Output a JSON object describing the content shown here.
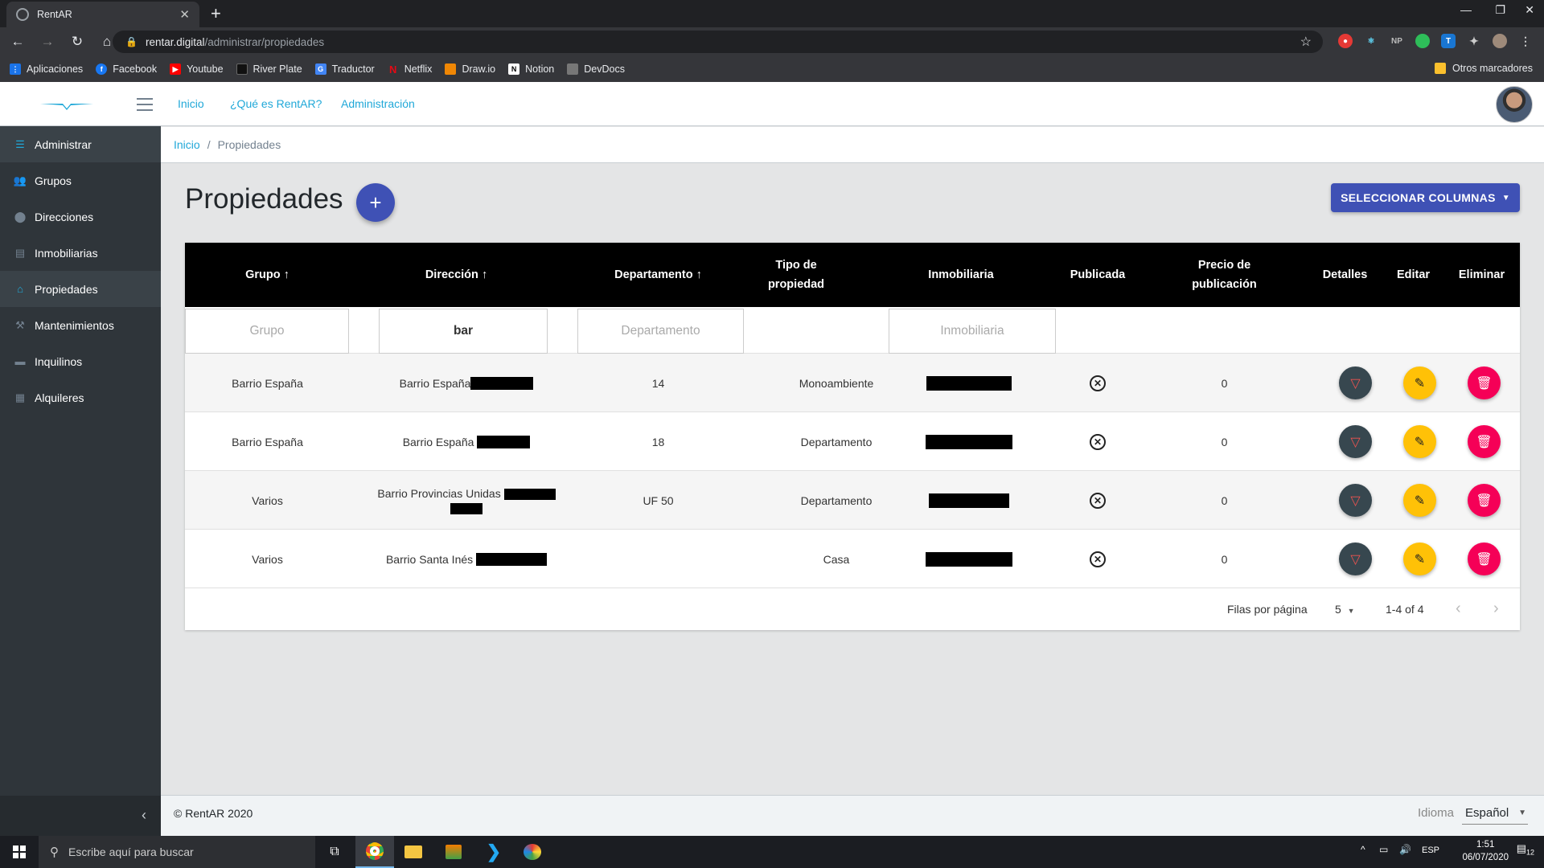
{
  "browser": {
    "tab_title": "RentAR",
    "url_host": "rentar.digital",
    "url_path": "/administrar/propiedades",
    "extensions": [
      "NP"
    ],
    "bookmarks": [
      "Aplicaciones",
      "Facebook",
      "Youtube",
      "River Plate",
      "Traductor",
      "Netflix",
      "Draw.io",
      "Notion",
      "DevDocs"
    ],
    "other_bookmarks": "Otros marcadores"
  },
  "header": {
    "nav": [
      "Inicio",
      "¿Qué es RentAR?",
      "Administración"
    ]
  },
  "sidebar": {
    "items": [
      {
        "label": "Administrar",
        "icon": "list-icon"
      },
      {
        "label": "Grupos",
        "icon": "users-icon"
      },
      {
        "label": "Direcciones",
        "icon": "map-pin-icon"
      },
      {
        "label": "Inmobiliarias",
        "icon": "building-icon"
      },
      {
        "label": "Propiedades",
        "icon": "home-icon"
      },
      {
        "label": "Mantenimientos",
        "icon": "hammer-icon"
      },
      {
        "label": "Inquilinos",
        "icon": "bed-icon"
      },
      {
        "label": "Alquileres",
        "icon": "document-icon"
      }
    ]
  },
  "breadcrumb": {
    "home": "Inicio",
    "current": "Propiedades"
  },
  "page": {
    "title": "Propiedades",
    "select_columns": "SELECCIONAR COLUMNAS"
  },
  "table": {
    "columns": [
      {
        "label": "Grupo",
        "sort": "↑"
      },
      {
        "label": "Dirección",
        "sort": "↑"
      },
      {
        "label": "Departamento",
        "sort": "↑"
      },
      {
        "label": "Tipo de propiedad",
        "sort": ""
      },
      {
        "label": "Inmobiliaria",
        "sort": ""
      },
      {
        "label": "Publicada",
        "sort": ""
      },
      {
        "label": "Precio de publicación",
        "sort": ""
      },
      {
        "label": "Detalles",
        "sort": ""
      },
      {
        "label": "Editar",
        "sort": ""
      },
      {
        "label": "Eliminar",
        "sort": ""
      }
    ],
    "filters": {
      "grupo_placeholder": "Grupo",
      "direccion_value": "bar",
      "departamento_placeholder": "Departamento",
      "inmobiliaria_placeholder": "Inmobiliaria"
    },
    "rows": [
      {
        "grupo": "Barrio España",
        "direccion": "Barrio España",
        "departamento": "14",
        "tipo": "Monoambiente",
        "publicada": "⊗",
        "precio": "0"
      },
      {
        "grupo": "Barrio España",
        "direccion": "Barrio España",
        "departamento": "18",
        "tipo": "Departamento",
        "publicada": "⊗",
        "precio": "0"
      },
      {
        "grupo": "Varios",
        "direccion": "Barrio Provincias Unidas",
        "departamento": "UF 50",
        "tipo": "Departamento",
        "publicada": "⊗",
        "precio": "0"
      },
      {
        "grupo": "Varios",
        "direccion": "Barrio Santa Inés",
        "departamento": "",
        "tipo": "Casa",
        "publicada": "⊗",
        "precio": "0"
      }
    ],
    "pagination": {
      "rows_per_page_label": "Filas por página",
      "rows_per_page": "5",
      "range": "1-4 of 4"
    }
  },
  "footer": {
    "copyright": "© RentAR 2020",
    "language_label": "Idioma",
    "language": "Español"
  },
  "taskbar": {
    "search_placeholder": "Escribe aquí para buscar",
    "lang": "ESP",
    "time": "1:51",
    "date": "06/07/2020",
    "notifications": "12"
  }
}
